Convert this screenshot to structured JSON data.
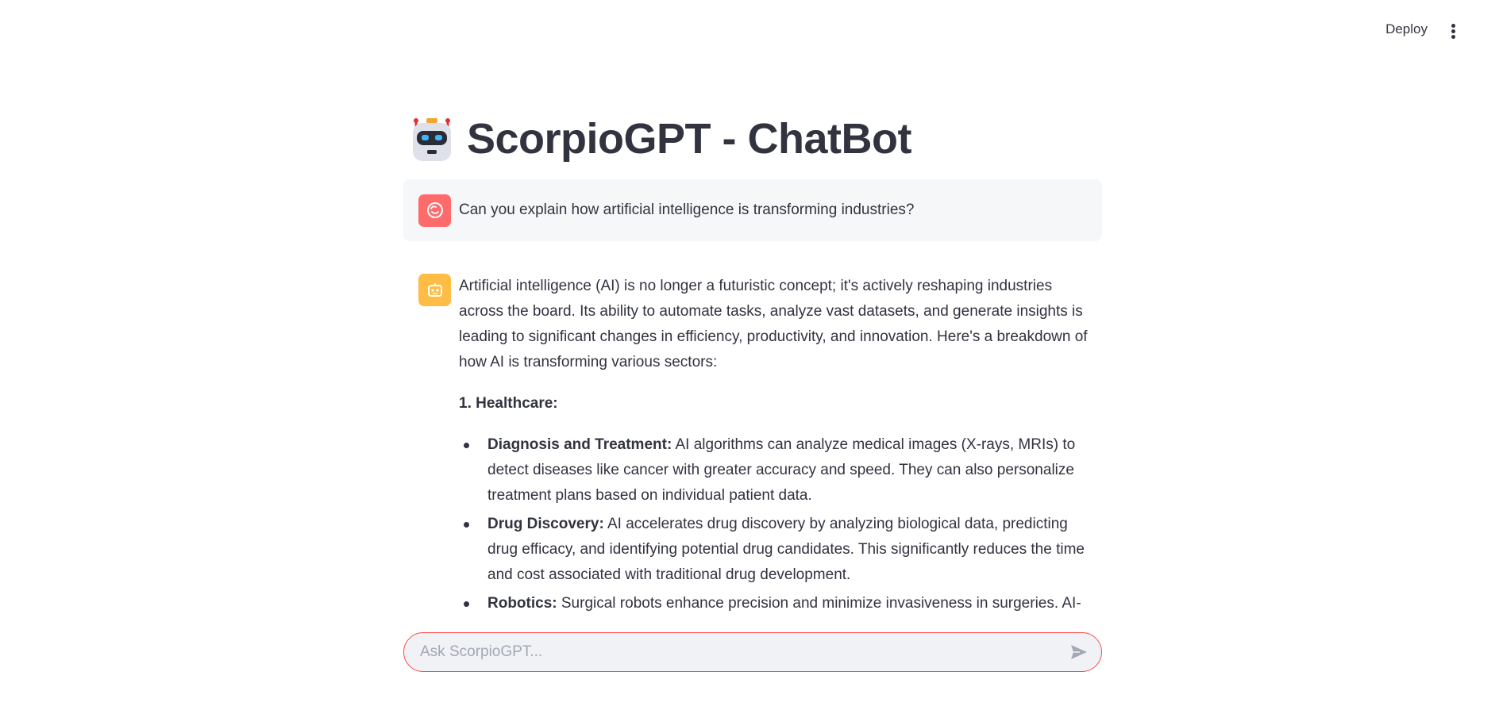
{
  "header": {
    "deploy_label": "Deploy",
    "menu_icon": "kebab-menu-icon"
  },
  "app": {
    "title": "ScorpioGPT - ChatBot",
    "title_icon": "robot-emoji-icon"
  },
  "messages": {
    "user": {
      "avatar_icon": "smiley-face-icon",
      "text": "Can you explain how artificial intelligence is transforming industries?"
    },
    "assistant": {
      "avatar_icon": "robot-face-icon",
      "intro": "Artificial intelligence (AI) is no longer a futuristic concept; it's actively reshaping industries across the board. Its ability to automate tasks, analyze vast datasets, and generate insights is leading to significant changes in efficiency, productivity, and innovation. Here's a breakdown of how AI is transforming various sectors:",
      "section_heading": "1. Healthcare:",
      "bullets": [
        {
          "bold": "Diagnosis and Treatment:",
          "text": " AI algorithms can analyze medical images (X-rays, MRIs) to detect diseases like cancer with greater accuracy and speed. They can also personalize treatment plans based on individual patient data."
        },
        {
          "bold": "Drug Discovery:",
          "text": " AI accelerates drug discovery by analyzing biological data, predicting drug efficacy, and identifying potential drug candidates. This significantly reduces the time and cost associated with traditional drug development."
        },
        {
          "bold": "Robotics:",
          "text": " Surgical robots enhance precision and minimize invasiveness in surgeries. AI-"
        }
      ]
    }
  },
  "chat_input": {
    "placeholder": "Ask ScorpioGPT...",
    "value": "",
    "send_icon": "send-icon"
  },
  "colors": {
    "accent": "#ff4b4b",
    "user_avatar": "#ff6b6b",
    "bot_avatar": "#ffbd45",
    "text": "#31333f"
  }
}
